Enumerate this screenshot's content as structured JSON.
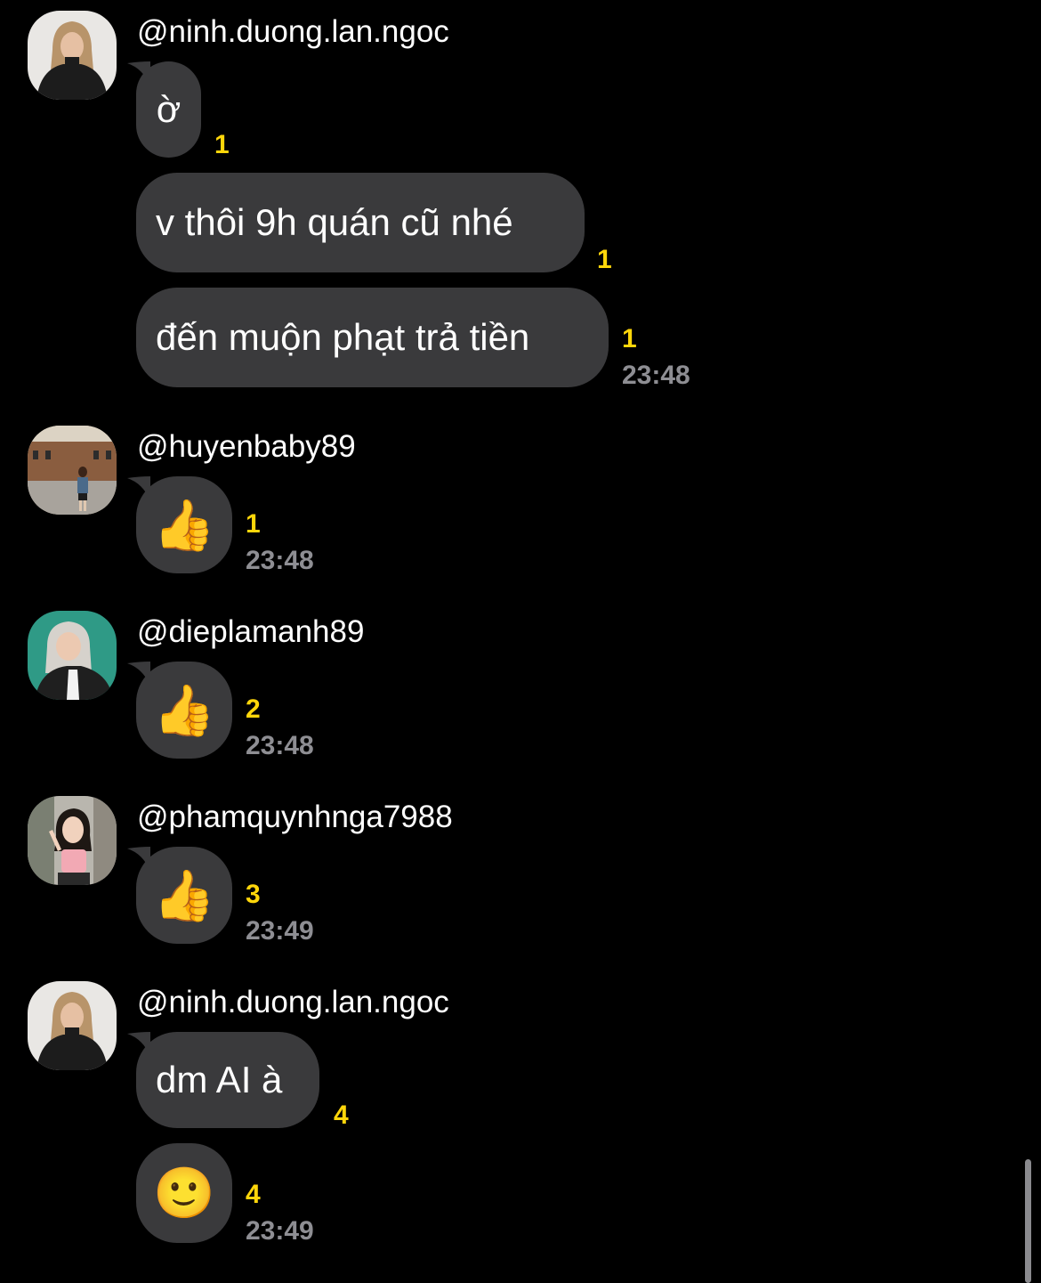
{
  "groups": [
    {
      "sender": "@ninh.duong.lan.ngoc",
      "messages": [
        {
          "text": "ờ",
          "count": "1"
        },
        {
          "text": "v thôi 9h quán cũ nhé",
          "count": "1"
        },
        {
          "text": "đến muộn phạt trả tiền",
          "count": "1",
          "time": "23:48"
        }
      ]
    },
    {
      "sender": "@huyenbaby89",
      "messages": [
        {
          "text": "👍",
          "count": "1",
          "time": "23:48"
        }
      ]
    },
    {
      "sender": "@dieplamanh89",
      "messages": [
        {
          "text": "👍",
          "count": "2",
          "time": "23:48"
        }
      ]
    },
    {
      "sender": "@phamquynhnga7988",
      "messages": [
        {
          "text": "👍",
          "count": "3",
          "time": "23:49"
        }
      ]
    },
    {
      "sender": "@ninh.duong.lan.ngoc",
      "messages": [
        {
          "text": "dm AI à",
          "count": "4"
        },
        {
          "text": "🙂",
          "count": "4",
          "time": "23:49"
        }
      ]
    }
  ],
  "colors": {
    "background": "#000000",
    "bubble": "#3a3a3c",
    "count": "#ffd60a",
    "time": "#8e8e93"
  }
}
